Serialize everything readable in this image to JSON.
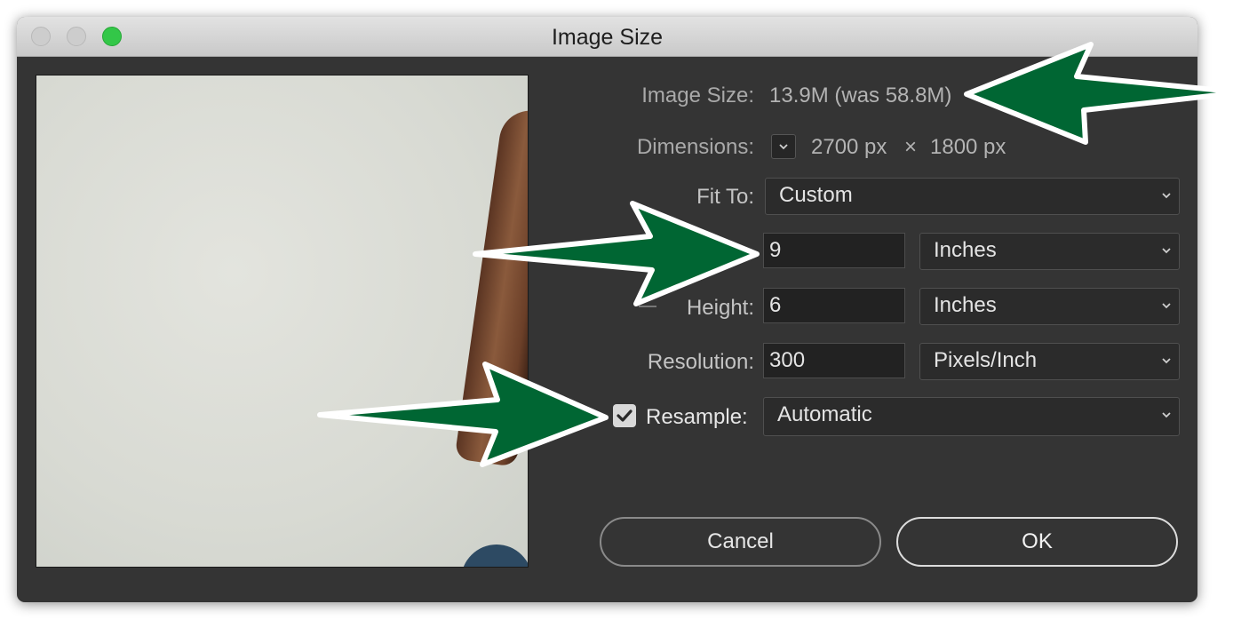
{
  "window": {
    "title": "Image Size"
  },
  "info": {
    "image_size_label": "Image Size:",
    "image_size_value": "13.9M (was 58.8M)",
    "dimensions_label": "Dimensions:",
    "dimensions_width": "2700 px",
    "dimensions_times": "×",
    "dimensions_height": "1800 px"
  },
  "fit_to": {
    "label": "Fit To:",
    "value": "Custom"
  },
  "width": {
    "value": "9",
    "unit": "Inches"
  },
  "height": {
    "label": "Height:",
    "value": "6",
    "unit": "Inches"
  },
  "resolution": {
    "label": "Resolution:",
    "value": "300",
    "unit": "Pixels/Inch"
  },
  "resample": {
    "label": "Resample:",
    "checked": true,
    "value": "Automatic"
  },
  "buttons": {
    "cancel": "Cancel",
    "ok": "OK"
  },
  "colors": {
    "annotation_arrow": "#006633",
    "traffic_green": "#33c748"
  },
  "icons": [
    "chevron-down-icon",
    "checkmark-icon",
    "annotation-arrow"
  ]
}
